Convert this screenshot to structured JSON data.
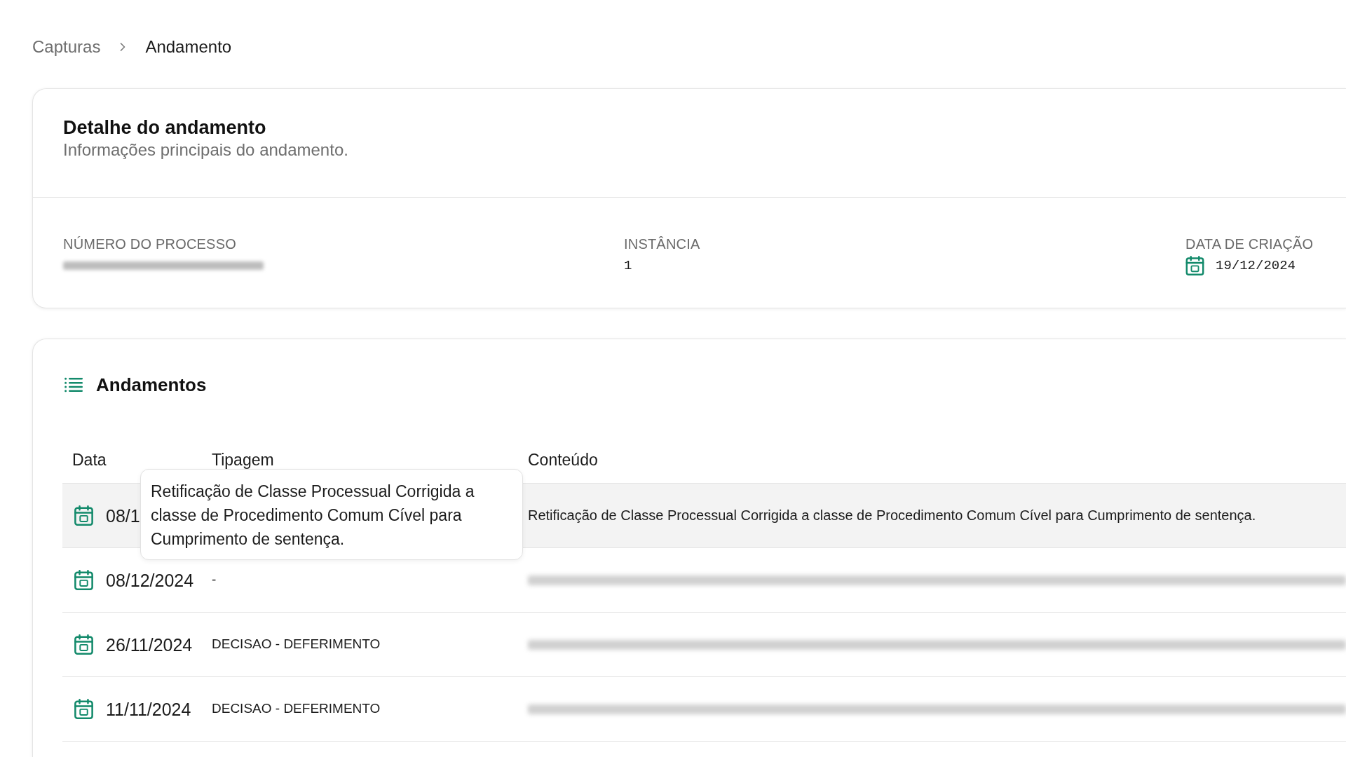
{
  "breadcrumb": [
    {
      "label": "Capturas",
      "current": false
    },
    {
      "label": "Andamento",
      "current": true
    }
  ],
  "detail_card": {
    "title": "Detalhe do andamento",
    "subtitle": "Informações principais do andamento.",
    "fields": [
      {
        "label": "NÚMERO DO PROCESSO",
        "kind": "blurred"
      },
      {
        "label": "INSTÂNCIA",
        "kind": "text",
        "value": "1"
      },
      {
        "label": "DATA DE CRIAÇÃO",
        "kind": "date",
        "value": "19/12/2024"
      }
    ]
  },
  "andamentos": {
    "title": "Andamentos",
    "columns": [
      "Data",
      "Tipagem",
      "Conteúdo"
    ],
    "rows": [
      {
        "hovered": true,
        "date": "08/1",
        "content": {
          "kind": "text",
          "text": "Retificação de Classe Processual Corrigida a classe de Procedimento Comum Cível para Cumprimento de sentença."
        },
        "tooltip": {
          "text": "Retificação de Classe Processual Corrigida a classe de Procedimento Comum Cível para Cumprimento de sentença."
        }
      },
      {
        "hovered": false,
        "date": "08/12/2024",
        "tipagem": "-",
        "content": {
          "kind": "blurred"
        }
      },
      {
        "hovered": false,
        "date": "26/11/2024",
        "tipagem": "DECISAO - DEFERIMENTO",
        "content": {
          "kind": "blurred"
        }
      },
      {
        "hovered": false,
        "date": "11/11/2024",
        "tipagem": "DECISAO - DEFERIMENTO",
        "content": {
          "kind": "blurred"
        }
      }
    ]
  }
}
